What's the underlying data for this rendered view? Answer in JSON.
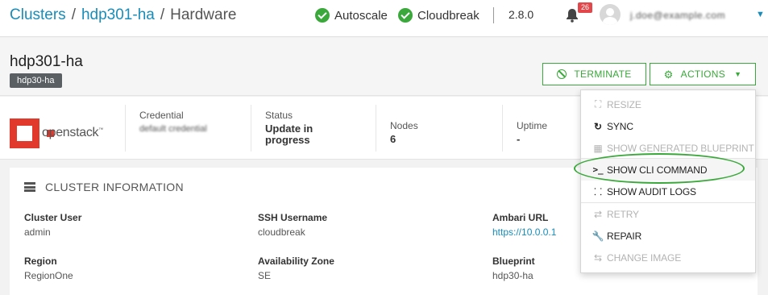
{
  "topbar": {
    "breadcrumb": [
      "Clusters",
      "hdp301-ha",
      "Hardware"
    ],
    "separator": "/",
    "services": [
      {
        "label": "Autoscale",
        "status": "ok"
      },
      {
        "label": "Cloudbreak",
        "status": "ok"
      }
    ],
    "version": "2.8.0",
    "notifications_count": "26",
    "user_name": "j.doe@example.com",
    "accent": "#1a8cb8",
    "ok_color": "#3aa83a"
  },
  "cluster": {
    "name": "hdp301-ha",
    "blueprint_tag": "hdp30-ha",
    "buttons": {
      "terminate": "TERMINATE",
      "actions": "ACTIONS"
    }
  },
  "stats": {
    "provider_logo": "openstack",
    "credential": {
      "label": "Credential",
      "value": "default credential"
    },
    "status": {
      "label": "Status",
      "value_line1": "Update in",
      "value_line2": "progress"
    },
    "nodes": {
      "label": "Nodes",
      "value": "6"
    },
    "uptime": {
      "label": "Uptime",
      "value": "-"
    }
  },
  "panel": {
    "title": "CLUSTER INFORMATION",
    "fields": {
      "cluster_user": {
        "label": "Cluster User",
        "value": "admin"
      },
      "ssh_username": {
        "label": "SSH Username",
        "value": "cloudbreak"
      },
      "ambari_url": {
        "label": "Ambari URL",
        "value": "https://10.0.0.1"
      },
      "region": {
        "label": "Region",
        "value": "RegionOne"
      },
      "availability_zone": {
        "label": "Availability Zone",
        "value": "SE"
      },
      "blueprint": {
        "label": "Blueprint",
        "value": "hdp30-ha"
      }
    }
  },
  "actions_menu": {
    "items": [
      {
        "label": "RESIZE",
        "icon": "expand-icon",
        "enabled": false
      },
      {
        "label": "SYNC",
        "icon": "sync-icon",
        "enabled": true
      },
      {
        "label": "SHOW GENERATED BLUEPRINT",
        "icon": "grid-icon",
        "enabled": false
      },
      {
        "label": "SHOW CLI COMMAND",
        "icon": "terminal-icon",
        "enabled": true,
        "highlighted": true
      },
      {
        "label": "SHOW AUDIT LOGS",
        "icon": "footprints-icon",
        "enabled": true
      },
      {
        "label": "RETRY",
        "icon": "retry-icon",
        "enabled": false
      },
      {
        "label": "REPAIR",
        "icon": "wrench-icon",
        "enabled": true
      },
      {
        "label": "CHANGE IMAGE",
        "icon": "exchange-icon",
        "enabled": false
      }
    ]
  }
}
